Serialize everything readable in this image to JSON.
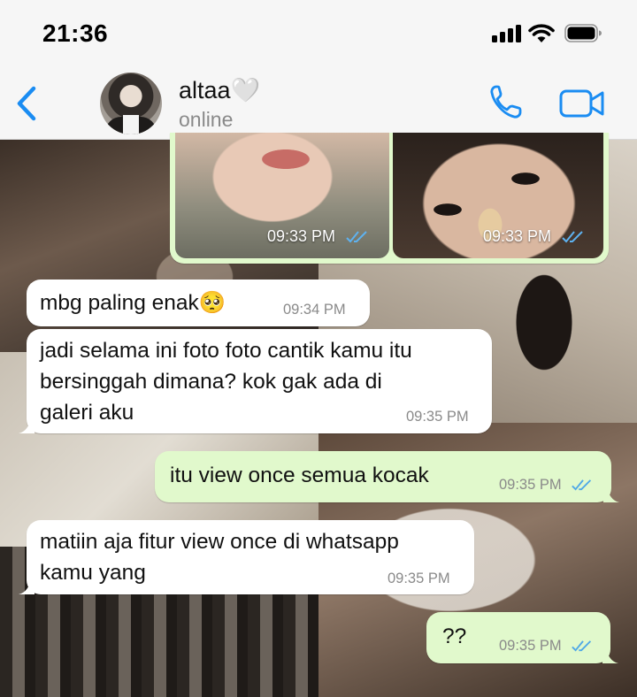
{
  "status_bar": {
    "time": "21:36"
  },
  "header": {
    "contact_name": "altaa🤍",
    "contact_status": "online"
  },
  "icons": {
    "back": "chevron-left-icon",
    "call": "phone-icon",
    "video": "video-camera-icon",
    "ticks": "double-check-icon"
  },
  "colors": {
    "accent": "#1a8cf2",
    "incoming_bubble": "#ffffff",
    "outgoing_bubble": "#e1f9cc",
    "read_ticks": "#4fa8e6"
  },
  "messages": [
    {
      "direction": "out",
      "type": "photos",
      "photos": [
        {
          "time": "09:33 PM"
        },
        {
          "time": "09:33 PM"
        }
      ]
    },
    {
      "direction": "in",
      "text": "mbg paling enak🥺",
      "time": "09:34 PM"
    },
    {
      "direction": "in",
      "text": "jadi selama ini foto foto cantik kamu itu\nbersinggah dimana? kok gak ada di\ngaleri aku",
      "time": "09:35 PM"
    },
    {
      "direction": "out",
      "text": "itu view once semua kocak",
      "time": "09:35 PM"
    },
    {
      "direction": "in",
      "text": "matiin aja fitur view once di whatsapp\nkamu yang",
      "time": "09:35 PM"
    },
    {
      "direction": "out",
      "text": "??",
      "time": "09:35 PM"
    }
  ]
}
